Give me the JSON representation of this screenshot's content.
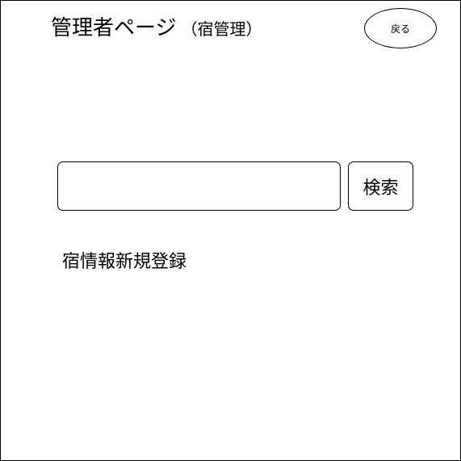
{
  "header": {
    "title": "管理者ページ",
    "subtitle": "（宿管理）"
  },
  "back_button": {
    "label": "戻る"
  },
  "search": {
    "value": "",
    "placeholder": "",
    "button_label": "検索"
  },
  "actions": {
    "register_label": "宿情報新規登録"
  }
}
